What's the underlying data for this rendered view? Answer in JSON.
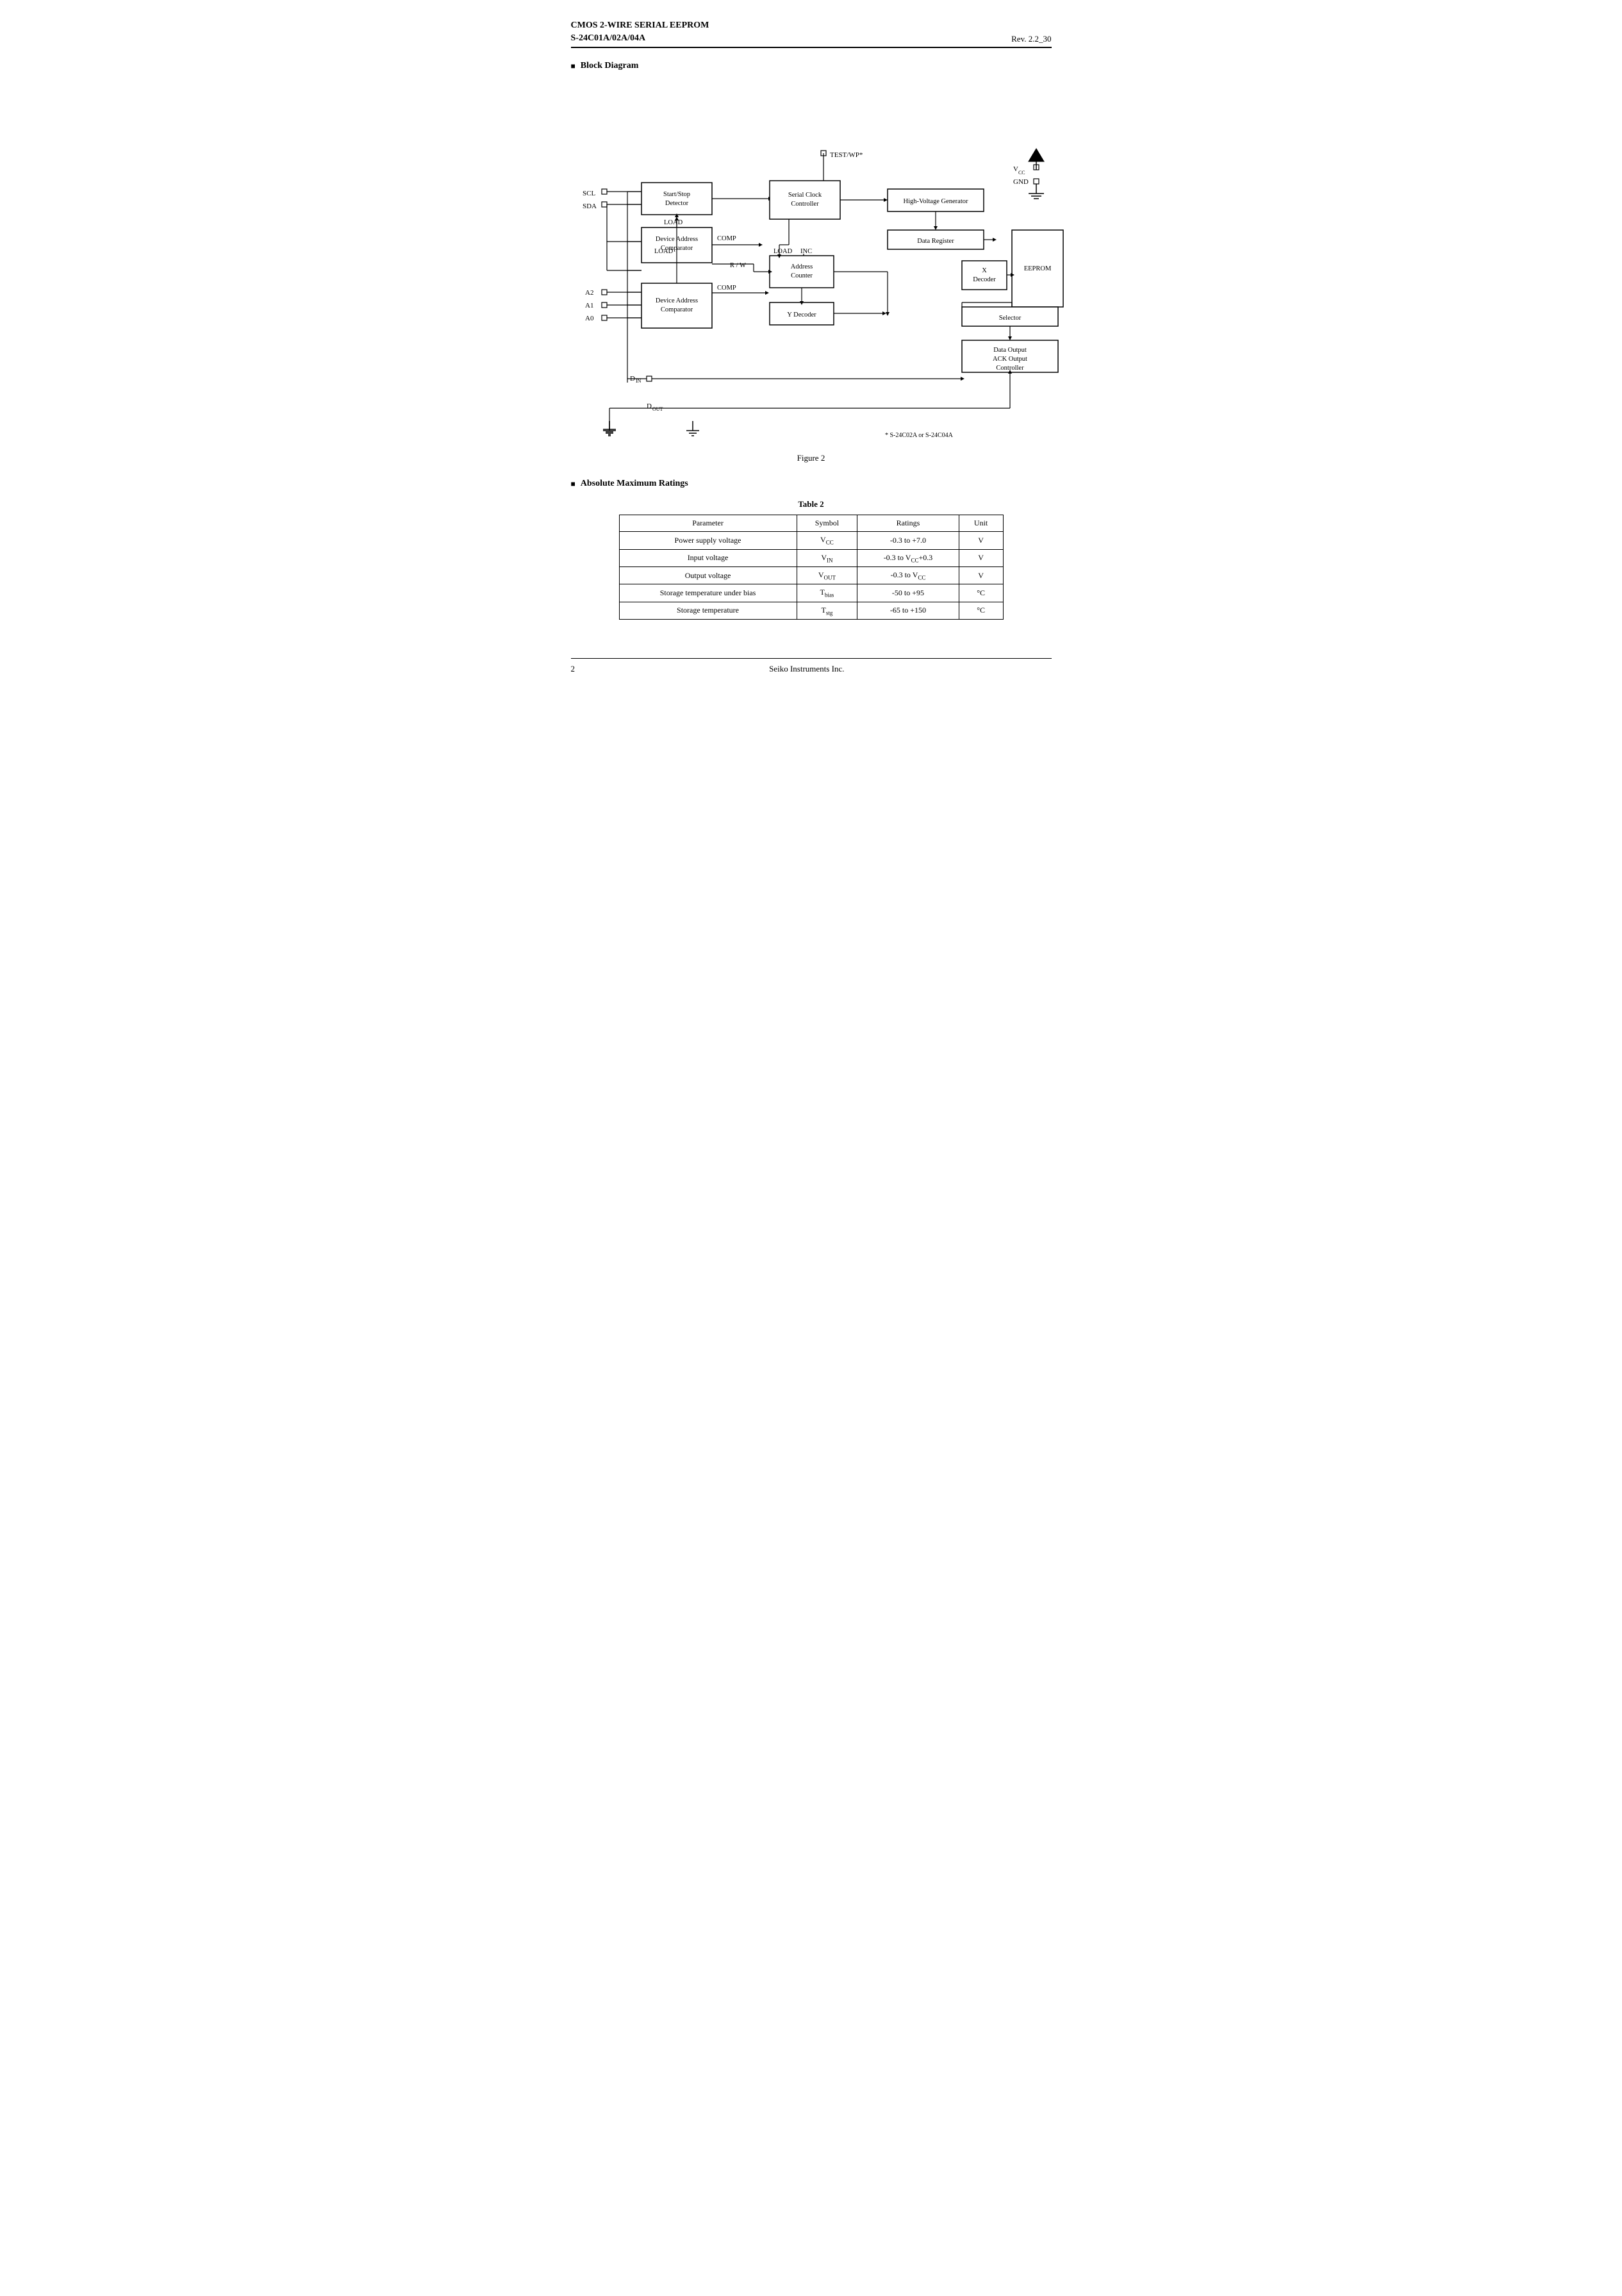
{
  "header": {
    "title_line1": "CMOS 2-WIRE SERIAL  EEPROM",
    "title_line2": "S-24C01A/02A/04A",
    "revision": "Rev. 2.2_30"
  },
  "sections": {
    "block_diagram": {
      "label": "Block Diagram",
      "figure_caption": "Figure 2",
      "footnote": "*   S-24C02A or S-24C04A",
      "boxes": {
        "start_stop": "Start/Stop\nDetector",
        "serial_clock": "Serial Clock\nController",
        "high_voltage": "High-Voltage Generator",
        "device_address": "Device Address\nComparator",
        "data_register": "Data Register",
        "x_decoder": "X\nDecoder",
        "eeprom": "EEPROM",
        "address_counter": "Address\nCounter",
        "y_decoder": "Y Decoder",
        "selector": "Selector",
        "data_output": "Data Output\nACK Output\nController"
      },
      "pins": {
        "scl": "SCL",
        "sda": "SDA",
        "a2": "A2",
        "a1": "A1",
        "a0": "A0",
        "din": "Dᴵₙ",
        "dout": "D₀ᵁᵀ",
        "test_wp": "TEST/WP*",
        "vcc": "Vᶜᶜ",
        "gnd": "GND"
      },
      "labels": {
        "load": "LOAD",
        "comp": "COMP",
        "load2": "LOAD",
        "inc": "INC",
        "rw": "R / W"
      }
    },
    "absolute_max_ratings": {
      "label": "Absolute Maximum Ratings",
      "table_title": "Table  2",
      "columns": [
        "Parameter",
        "Symbol",
        "Ratings",
        "Unit"
      ],
      "rows": [
        {
          "parameter": "Power supply voltage",
          "symbol": "V_CC",
          "ratings": "-0.3 to +7.0",
          "unit": "V"
        },
        {
          "parameter": "Input voltage",
          "symbol": "V_IN",
          "ratings": "-0.3 to V_CC+0.3",
          "unit": "V"
        },
        {
          "parameter": "Output voltage",
          "symbol": "V_OUT",
          "ratings": "-0.3 to V_CC",
          "unit": "V"
        },
        {
          "parameter": "Storage temperature under bias",
          "symbol": "T_bias",
          "ratings": "-50 to +95",
          "unit": "°C"
        },
        {
          "parameter": "Storage temperature",
          "symbol": "T_stg",
          "ratings": "-65 to +150",
          "unit": "°C"
        }
      ]
    }
  },
  "footer": {
    "page_number": "2",
    "company": "Seiko Instruments Inc."
  }
}
